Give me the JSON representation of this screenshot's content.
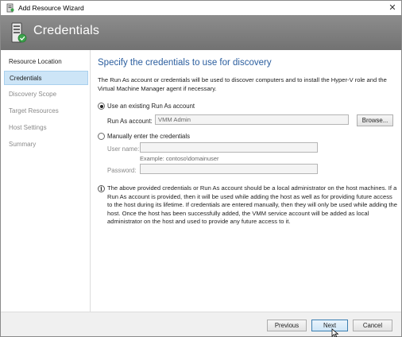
{
  "window": {
    "title": "Add Resource Wizard",
    "close_glyph": "✕"
  },
  "header": {
    "title": "Credentials",
    "icon": "server-credentials-icon"
  },
  "sidebar": {
    "items": [
      {
        "label": "Resource Location",
        "state": "done"
      },
      {
        "label": "Credentials",
        "state": "active"
      },
      {
        "label": "Discovery Scope",
        "state": "future"
      },
      {
        "label": "Target Resources",
        "state": "future"
      },
      {
        "label": "Host Settings",
        "state": "future"
      },
      {
        "label": "Summary",
        "state": "future"
      }
    ]
  },
  "main": {
    "heading": "Specify the credentials to use for discovery",
    "description": "The Run As account or credentials will be used to discover computers and to install the Hyper-V role and the Virtual Machine Manager agent if necessary.",
    "option_existing": {
      "label": "Use an existing Run As account",
      "selected": true,
      "run_as_label": "Run As account:",
      "run_as_value": "VMM Admin",
      "browse_label": "Browse..."
    },
    "option_manual": {
      "label": "Manually enter the credentials",
      "selected": false,
      "username_label": "User name:",
      "username_value": "",
      "username_example": "Example: contoso\\domainuser",
      "password_label": "Password:",
      "password_value": ""
    },
    "info_icon": "info-icon",
    "info_text": "The above provided credentials or Run As account should be a local administrator on the host machines. If a Run As account is provided, then it will be used while adding the host as well as for providing future access to the host during its lifetime. If credentials are entered manually, then they will only be used while adding the host. Once the host has been successfully added, the VMM service account will be added as local administrator on the host and used to provide any future access to it."
  },
  "footer": {
    "previous_label": "Previous",
    "next_label": "Next",
    "cancel_label": "Cancel"
  },
  "colors": {
    "heading": "#2a5d9e",
    "header_bg": "#7f7f7f",
    "active_nav_bg": "#cde5f7"
  }
}
